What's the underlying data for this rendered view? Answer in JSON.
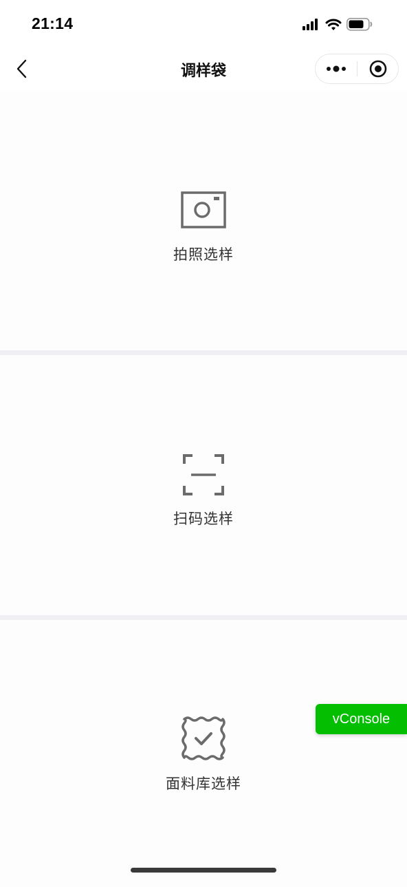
{
  "status_bar": {
    "time": "21:14",
    "icons": [
      "signal-icon",
      "wifi-icon",
      "battery-icon"
    ]
  },
  "nav": {
    "title": "调样袋",
    "back_icon": "chevron-left-icon",
    "more_icon": "more-dots-icon",
    "close_icon": "target-circle-icon"
  },
  "options": [
    {
      "label": "拍照选样",
      "icon": "camera-icon"
    },
    {
      "label": "扫码选样",
      "icon": "scan-frame-icon"
    },
    {
      "label": "面料库选样",
      "icon": "fabric-swatch-check-icon"
    }
  ],
  "vconsole": {
    "label": "vConsole"
  },
  "colors": {
    "vconsole_bg": "#04be02",
    "separator": "#f0eff4",
    "icon": "#6b6b6b"
  }
}
